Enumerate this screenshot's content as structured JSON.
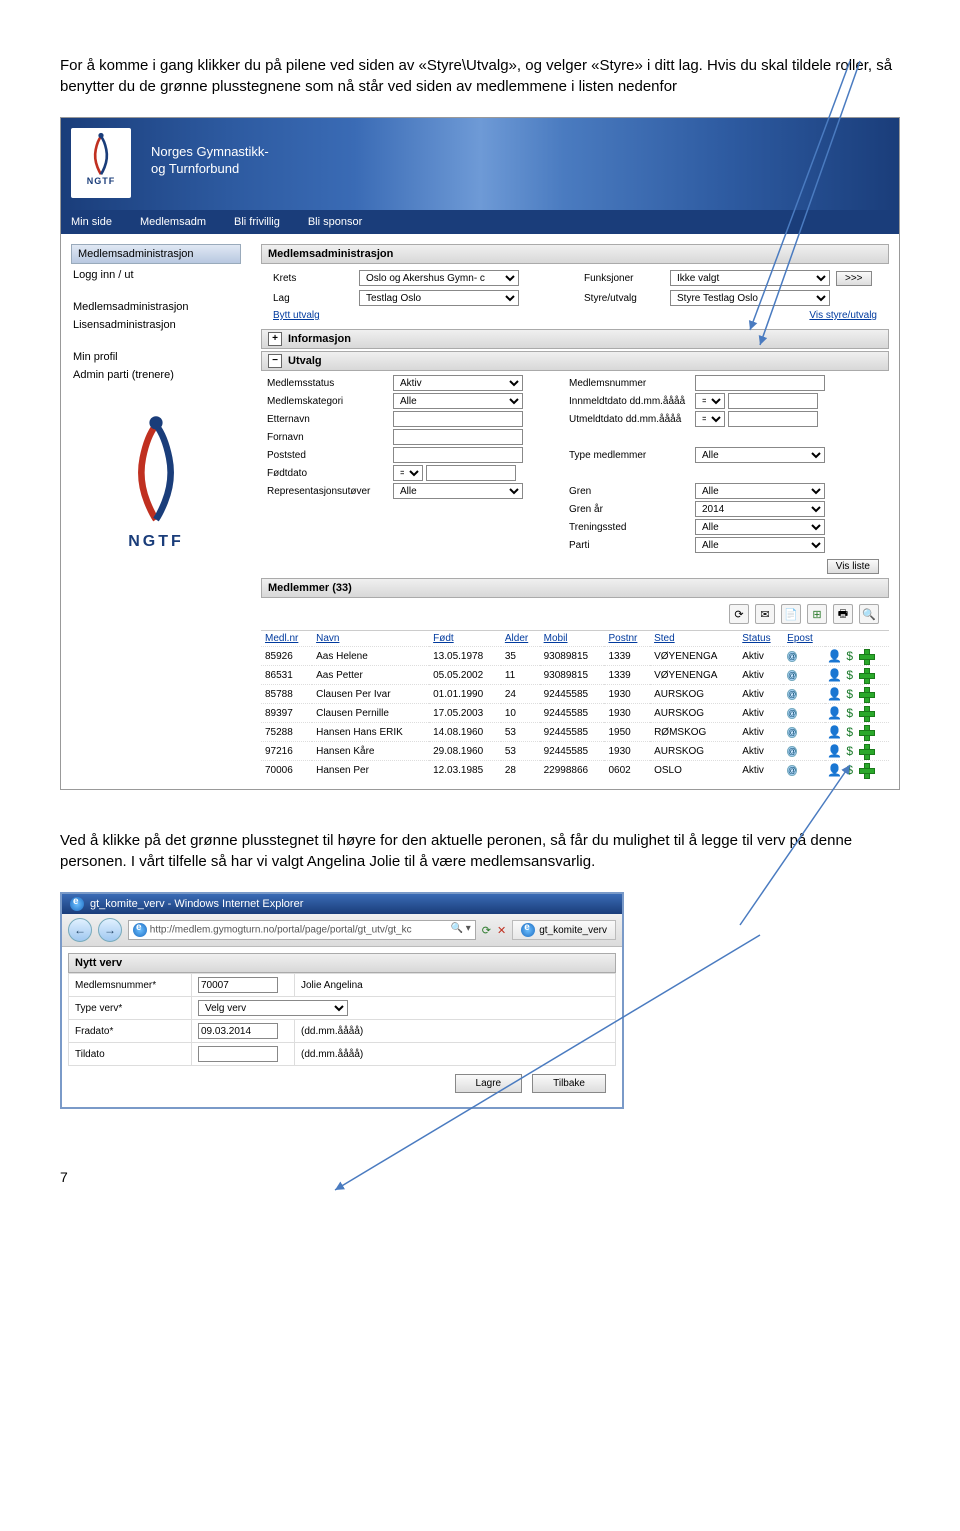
{
  "doc": {
    "para1": "For å komme i gang klikker du på pilene ved siden av «Styre\\Utvalg», og velger «Styre» i ditt lag. Hvis du skal tildele roller, så benytter du de grønne plusstegnene som nå står ved siden av medlemmene i listen nedenfor",
    "para2": "Ved å klikke på det grønne plusstegnet til høyre for den aktuelle peronen, så får du mulighet til å legge til verv på denne personen. I vårt tilfelle så har vi valgt Angelina Jolie til å være medlemsansvarlig.",
    "page_num": "7"
  },
  "banner": {
    "org_line1": "Norges Gymnastikk-",
    "org_line2": "og Turnforbund",
    "ngtf": "NGTF"
  },
  "menubar": {
    "m1": "Min side",
    "m2": "Medlemsadm",
    "m3": "Bli frivillig",
    "m4": "Bli sponsor"
  },
  "sidebar": {
    "head": "Medlemsadministrasjon",
    "i1": "Logg inn / ut",
    "i2": "Medlemsadministrasjon",
    "i3": "Lisensadministrasjon",
    "i4": "Min profil",
    "i5": "Admin parti (trenere)",
    "ngtf": "NGTF"
  },
  "main": {
    "panel_title": "Medlemsadministrasjon",
    "krets": "Krets",
    "krets_val": "Oslo og Akershus Gymn- c",
    "lag": "Lag",
    "lag_val": "Testlag Oslo",
    "bytt": "Bytt utvalg",
    "funksjoner": "Funksjoner",
    "funksjoner_val": "Ikke valgt",
    "styre": "Styre/utvalg",
    "styre_val": "Styre Testlag Oslo",
    "vis_styre": "Vis styre/utvalg",
    "arrows": ">>>",
    "sec_info": "Informasjon",
    "sec_utvalg": "Utvalg",
    "f": {
      "medlemsstatus": "Medlemsstatus",
      "medlemsstatus_v": "Aktiv",
      "medlemskategori": "Medlemskategori",
      "medlemskategori_v": "Alle",
      "etternavn": "Etternavn",
      "fornavn": "Fornavn",
      "poststed": "Poststed",
      "fodtdato": "Fødtdato",
      "repr": "Representasjonsutøver",
      "repr_v": "Alle",
      "medlemsnummer": "Medlemsnummer",
      "innmeldt": "Innmeldtdato dd.mm.åååå",
      "utmeldt": "Utmeldtdato dd.mm.åååå",
      "type": "Type medlemmer",
      "type_v": "Alle",
      "gren": "Gren",
      "gren_v": "Alle",
      "gren_ar": "Gren år",
      "gren_ar_v": "2014",
      "treningssted": "Treningssted",
      "treningssted_v": "Alle",
      "parti": "Parti",
      "parti_v": "Alle"
    },
    "vis_liste": "Vis liste",
    "members_title": "Medlemmer  (33)",
    "cols": {
      "medlnr": "Medl.nr",
      "navn": "Navn",
      "fodt": "Født",
      "alder": "Alder",
      "mobil": "Mobil",
      "postnr": "Postnr",
      "sted": "Sted",
      "status": "Status",
      "epost": "Epost"
    },
    "rows": [
      {
        "nr": "85926",
        "navn": "Aas Helene",
        "fodt": "13.05.1978",
        "alder": "35",
        "mobil": "93089815",
        "postnr": "1339",
        "sted": "VØYENENGA",
        "status": "Aktiv"
      },
      {
        "nr": "86531",
        "navn": "Aas Petter",
        "fodt": "05.05.2002",
        "alder": "11",
        "mobil": "93089815",
        "postnr": "1339",
        "sted": "VØYENENGA",
        "status": "Aktiv"
      },
      {
        "nr": "85788",
        "navn": "Clausen Per Ivar",
        "fodt": "01.01.1990",
        "alder": "24",
        "mobil": "92445585",
        "postnr": "1930",
        "sted": "AURSKOG",
        "status": "Aktiv"
      },
      {
        "nr": "89397",
        "navn": "Clausen Pernille",
        "fodt": "17.05.2003",
        "alder": "10",
        "mobil": "92445585",
        "postnr": "1930",
        "sted": "AURSKOG",
        "status": "Aktiv"
      },
      {
        "nr": "75288",
        "navn": "Hansen Hans ERIK",
        "fodt": "14.08.1960",
        "alder": "53",
        "mobil": "92445585",
        "postnr": "1950",
        "sted": "RØMSKOG",
        "status": "Aktiv"
      },
      {
        "nr": "97216",
        "navn": "Hansen Kåre",
        "fodt": "29.08.1960",
        "alder": "53",
        "mobil": "92445585",
        "postnr": "1930",
        "sted": "AURSKOG",
        "status": "Aktiv"
      },
      {
        "nr": "70006",
        "navn": "Hansen Per",
        "fodt": "12.03.1985",
        "alder": "28",
        "mobil": "22998866",
        "postnr": "0602",
        "sted": "OSLO",
        "status": "Aktiv"
      }
    ]
  },
  "dialog": {
    "title": "gt_komite_verv - Windows Internet Explorer",
    "url": "http://medlem.gymogturn.no/portal/page/portal/gt_utv/gt_kc",
    "tab": "gt_komite_verv",
    "panel": "Nytt verv",
    "fields": {
      "medlnr": "Medlemsnummer*",
      "medlnr_v": "70007",
      "name_v": "Jolie Angelina",
      "type": "Type verv*",
      "type_v": "Velg verv",
      "fra": "Fradato*",
      "fra_v": "09.03.2014",
      "til": "Tildato",
      "fmt": "(dd.mm.åååå)"
    },
    "btn_lagre": "Lagre",
    "btn_tilbake": "Tilbake"
  }
}
